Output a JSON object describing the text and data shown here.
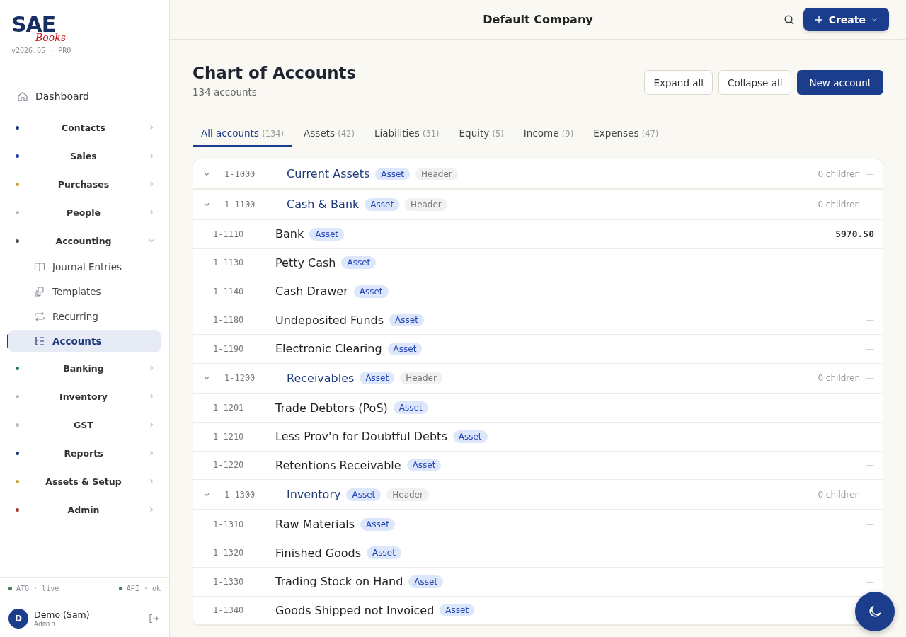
{
  "logo": {
    "main": "SAE",
    "sub": "Books"
  },
  "version": "v2026.05 · PRO",
  "sidebar": {
    "items": [
      {
        "label": "Dashboard",
        "kind": "link",
        "selected": false
      },
      {
        "label": "Contacts",
        "kind": "group",
        "color": "#1e3a7a",
        "expanded": false
      },
      {
        "label": "Sales",
        "kind": "group",
        "color": "#1e40af",
        "expanded": false
      },
      {
        "label": "Purchases",
        "kind": "group",
        "color": "#c9a23a",
        "expanded": false
      },
      {
        "label": "People",
        "kind": "group",
        "color": "#b8bcc4",
        "expanded": false
      },
      {
        "label": "Accounting",
        "kind": "group",
        "color": "#4a4f5a",
        "expanded": true,
        "children": [
          {
            "label": "Journal Entries",
            "selected": false
          },
          {
            "label": "Templates",
            "selected": false
          },
          {
            "label": "Recurring",
            "selected": false
          },
          {
            "label": "Accounts",
            "selected": true
          }
        ]
      },
      {
        "label": "Banking",
        "kind": "group",
        "color": "#2e7d4f",
        "expanded": false
      },
      {
        "label": "Inventory",
        "kind": "group",
        "color": "#b8bcc4",
        "expanded": false
      },
      {
        "label": "GST",
        "kind": "group",
        "color": "#b8bcc4",
        "expanded": false
      },
      {
        "label": "Reports",
        "kind": "group",
        "color": "#1e3a7a",
        "expanded": false
      },
      {
        "label": "Assets & Setup",
        "kind": "group",
        "color": "#c9a23a",
        "expanded": false
      },
      {
        "label": "Admin",
        "kind": "group",
        "color": "#a63a32",
        "expanded": false
      }
    ]
  },
  "status": [
    {
      "label": "ATO · live",
      "color": "#3f7d4f"
    },
    {
      "label": "API · ok",
      "color": "#3f7d4f"
    }
  ],
  "user": {
    "initial": "D",
    "name": "Demo (Sam)",
    "role": "Admin"
  },
  "header": {
    "title": "Default Company",
    "create": "Create"
  },
  "page": {
    "title": "Chart of Accounts",
    "subtitle": "134 accounts",
    "buttons": [
      {
        "label": "Expand all",
        "kind": "secondary"
      },
      {
        "label": "Collapse all",
        "kind": "secondary"
      },
      {
        "label": "New account",
        "kind": "primary"
      }
    ]
  },
  "tabs": [
    {
      "label": "All accounts",
      "count": "(134)",
      "selected": true
    },
    {
      "label": "Assets",
      "count": "(42)",
      "selected": false
    },
    {
      "label": "Liabilities",
      "count": "(31)",
      "selected": false
    },
    {
      "label": "Equity",
      "count": "(5)",
      "selected": false
    },
    {
      "label": "Income",
      "count": "(9)",
      "selected": false
    },
    {
      "label": "Expenses",
      "count": "(47)",
      "selected": false
    }
  ],
  "accounts": [
    {
      "kind": "header",
      "expanded": true,
      "code": "1-1000",
      "name": "Current Assets",
      "type": "Asset",
      "tag": "Header",
      "info": "0 children",
      "balance": "—"
    },
    {
      "kind": "header",
      "expanded": true,
      "code": "1-1100",
      "name": "Cash & Bank",
      "type": "Asset",
      "tag": "Header",
      "info": "0 children",
      "balance": "—"
    },
    {
      "kind": "leaf",
      "code": "1-1110",
      "name": "Bank",
      "type": "Asset",
      "balance": "5970.50"
    },
    {
      "kind": "leaf",
      "code": "1-1130",
      "name": "Petty Cash",
      "type": "Asset",
      "balance": "—"
    },
    {
      "kind": "leaf",
      "code": "1-1140",
      "name": "Cash Drawer",
      "type": "Asset",
      "balance": "—"
    },
    {
      "kind": "leaf",
      "code": "1-1180",
      "name": "Undeposited Funds",
      "type": "Asset",
      "balance": "—"
    },
    {
      "kind": "leaf",
      "code": "1-1190",
      "name": "Electronic Clearing",
      "type": "Asset",
      "balance": "—"
    },
    {
      "kind": "header",
      "expanded": true,
      "code": "1-1200",
      "name": "Receivables",
      "type": "Asset",
      "tag": "Header",
      "info": "0 children",
      "balance": "—"
    },
    {
      "kind": "leaf",
      "code": "1-1201",
      "name": "Trade Debtors (PoS)",
      "type": "Asset",
      "balance": "—"
    },
    {
      "kind": "leaf",
      "code": "1-1210",
      "name": "Less Prov'n for Doubtful Debts",
      "type": "Asset",
      "balance": "—"
    },
    {
      "kind": "leaf",
      "code": "1-1220",
      "name": "Retentions Receivable",
      "type": "Asset",
      "balance": "—"
    },
    {
      "kind": "header",
      "expanded": true,
      "code": "1-1300",
      "name": "Inventory",
      "type": "Asset",
      "tag": "Header",
      "info": "0 children",
      "balance": "—"
    },
    {
      "kind": "leaf",
      "code": "1-1310",
      "name": "Raw Materials",
      "type": "Asset",
      "balance": "—"
    },
    {
      "kind": "leaf",
      "code": "1-1320",
      "name": "Finished Goods",
      "type": "Asset",
      "balance": "—"
    },
    {
      "kind": "leaf",
      "code": "1-1330",
      "name": "Trading Stock on Hand",
      "type": "Asset",
      "balance": "—"
    },
    {
      "kind": "leaf",
      "code": "1-1340",
      "name": "Goods Shipped not Invoiced",
      "type": "Asset"
    }
  ]
}
